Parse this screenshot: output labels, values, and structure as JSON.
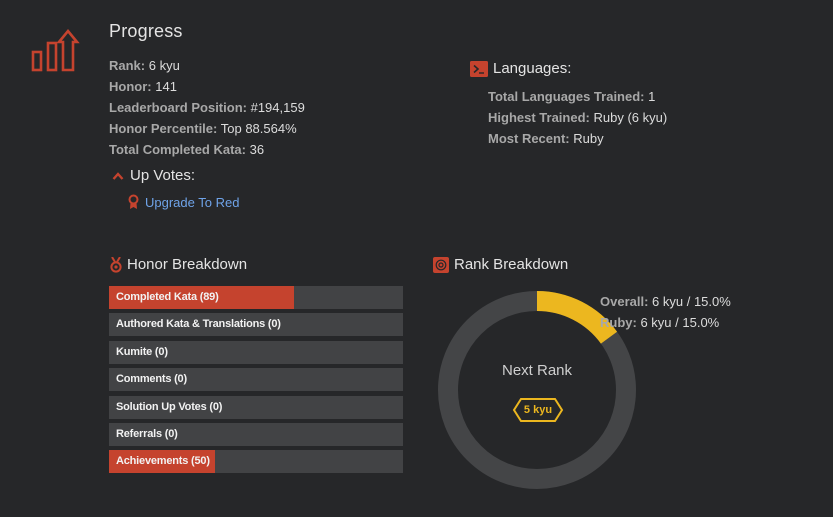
{
  "progress": {
    "title": "Progress",
    "stats": [
      {
        "label": "Rank:",
        "value": "6 kyu"
      },
      {
        "label": "Honor:",
        "value": "141"
      },
      {
        "label": "Leaderboard Position:",
        "value": "#194,159"
      },
      {
        "label": "Honor Percentile:",
        "value": "Top 88.564%"
      },
      {
        "label": "Total Completed Kata:",
        "value": "36"
      }
    ],
    "upvotes": {
      "title": "Up Votes:",
      "link": "Upgrade To Red"
    }
  },
  "languages": {
    "title": "Languages:",
    "stats": [
      {
        "label": "Total Languages Trained:",
        "value": "1"
      },
      {
        "label": "Highest Trained:",
        "value": "Ruby (6 kyu)"
      },
      {
        "label": "Most Recent:",
        "value": "Ruby"
      }
    ]
  },
  "honor_breakdown": {
    "title": "Honor Breakdown",
    "bars": [
      {
        "label": "Completed Kata (89)",
        "fill": 0.63
      },
      {
        "label": "Authored Kata & Translations (0)",
        "fill": 0
      },
      {
        "label": "Kumite (0)",
        "fill": 0
      },
      {
        "label": "Comments (0)",
        "fill": 0
      },
      {
        "label": "Solution Up Votes (0)",
        "fill": 0
      },
      {
        "label": "Referrals (0)",
        "fill": 0
      },
      {
        "label": "Achievements (50)",
        "fill": 0.36
      }
    ]
  },
  "rank_breakdown": {
    "title": "Rank Breakdown",
    "progress": 0.15,
    "next_rank_label": "Next Rank",
    "next_rank": "5 kyu",
    "stats": [
      {
        "label": "Overall:",
        "value": "6 kyu / 15.0%"
      },
      {
        "label": "Ruby:",
        "value": "6 kyu / 15.0%"
      }
    ]
  },
  "colors": {
    "background": "#262729",
    "accent_red": "#c5432e",
    "rank_yellow": "#ecb71f",
    "ring_track": "#444547",
    "link_blue": "#6fa3e8"
  }
}
